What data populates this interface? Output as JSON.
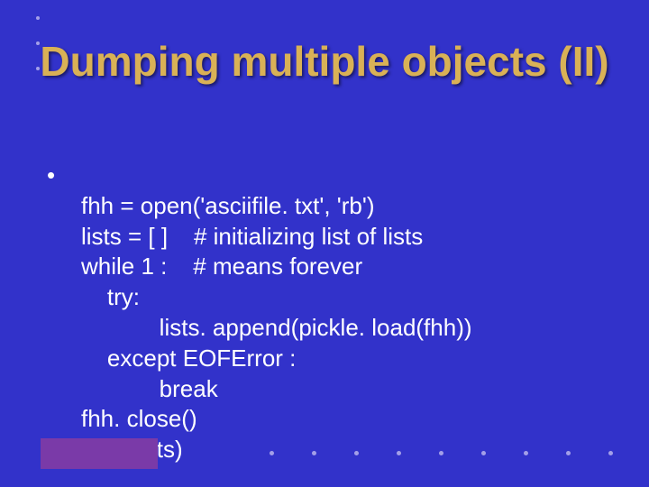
{
  "slide": {
    "title": "Dumping multiple objects (II)",
    "code_lines": [
      "fhh = open('asciifile. txt', 'rb')",
      "lists = [ ]    # initializing list of lists",
      "while 1 :    # means forever",
      "    try:",
      "            lists. append(pickle. load(fhh))",
      "    except EOFError :",
      "            break",
      "fhh. close()",
      "print(lists)"
    ]
  }
}
